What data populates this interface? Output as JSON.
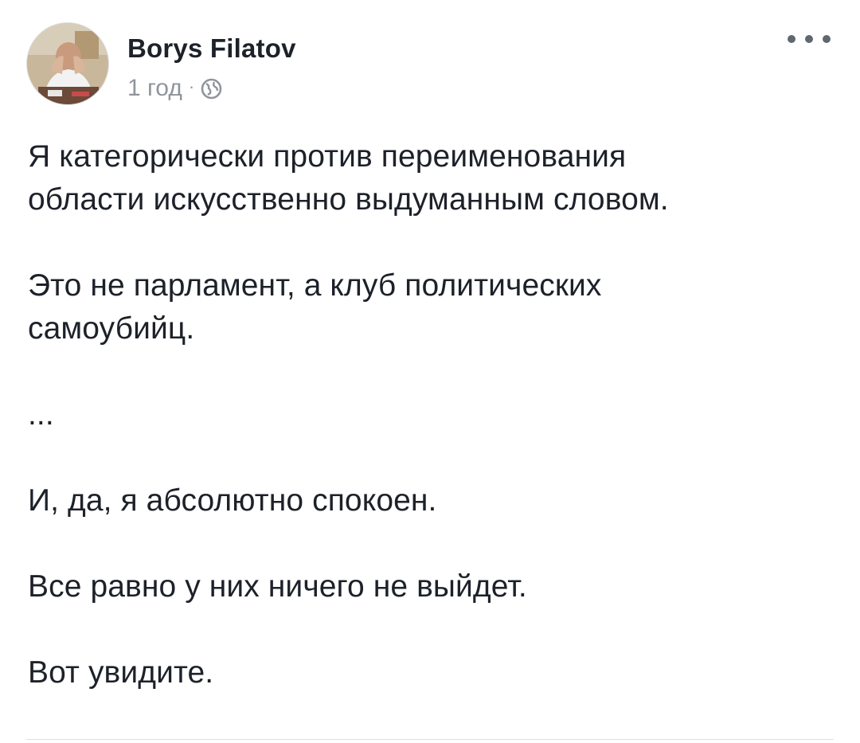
{
  "post": {
    "author": "Borys Filatov",
    "time": "1 год",
    "separator": "·",
    "privacy_icon": "globe-icon",
    "menu_icon": "more-dots-icon",
    "paragraphs": [
      "Я категорически против переименования\nобласти искусственно выдуманным словом.",
      "Это не парламент, а клуб политических\nсамоубийц.",
      "...",
      "И, да, я абсолютно спокоен.",
      "Все равно у них ничего не выйдет.",
      "Вот увидите."
    ]
  },
  "colors": {
    "text": "#1d2129",
    "meta": "#90949c",
    "divider": "#dddfe2",
    "background": "#ffffff"
  }
}
